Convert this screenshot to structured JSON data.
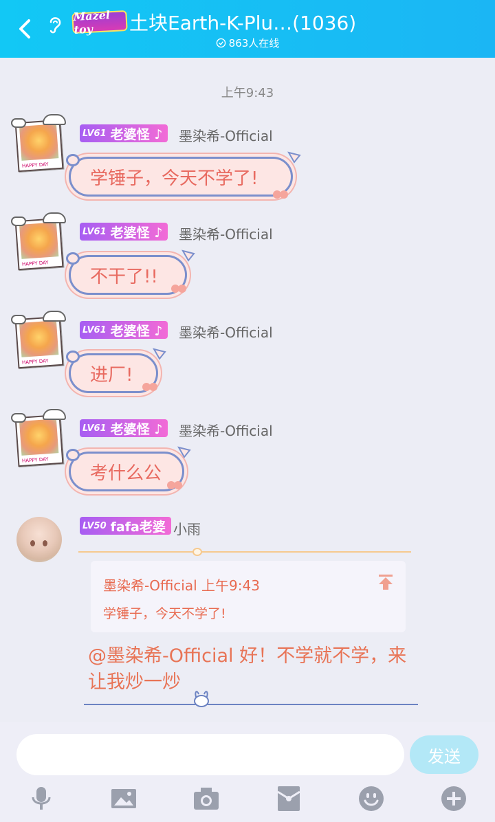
{
  "header": {
    "group_logo_text": "Mazel toy",
    "title": "土块Earth-K-Plu…(1036)",
    "online": "863人在线"
  },
  "timestamp": "上午9:43",
  "messages": [
    {
      "badge_level": "LV61",
      "badge_title": "老婆怪 ♪",
      "sender": "墨染希-Official",
      "text": "学锤子，今天不学了!"
    },
    {
      "badge_level": "LV61",
      "badge_title": "老婆怪 ♪",
      "sender": "墨染希-Official",
      "text": "不干了!!"
    },
    {
      "badge_level": "LV61",
      "badge_title": "老婆怪 ♪",
      "sender": "墨染希-Official",
      "text": "进厂!"
    },
    {
      "badge_level": "LV61",
      "badge_title": "老婆怪 ♪",
      "sender": "墨染希-Official",
      "text": "考什么公"
    }
  ],
  "reply": {
    "badge_level": "LV50",
    "badge_title": "fafa老婆",
    "sender": "小雨",
    "quote_header": "墨染希-Official 上午9:43",
    "quote_body": "学锤子，今天不学了!",
    "text": "@墨染希-Official 好！不学就不学，来让我炒一炒"
  },
  "input": {
    "placeholder": "",
    "send_label": "发送"
  },
  "toolbar_icons": [
    "microphone-icon",
    "image-icon",
    "camera-icon",
    "red-packet-icon",
    "emoji-icon",
    "plus-icon"
  ],
  "colors": {
    "header_bg": "#12c8f5",
    "bubble_bg": "#fde6e4",
    "bubble_text": "#e86a60",
    "badge_gradient_start": "#a75ef2",
    "badge_gradient_end": "#f26bd6",
    "send_button": "#b3e8f7"
  }
}
